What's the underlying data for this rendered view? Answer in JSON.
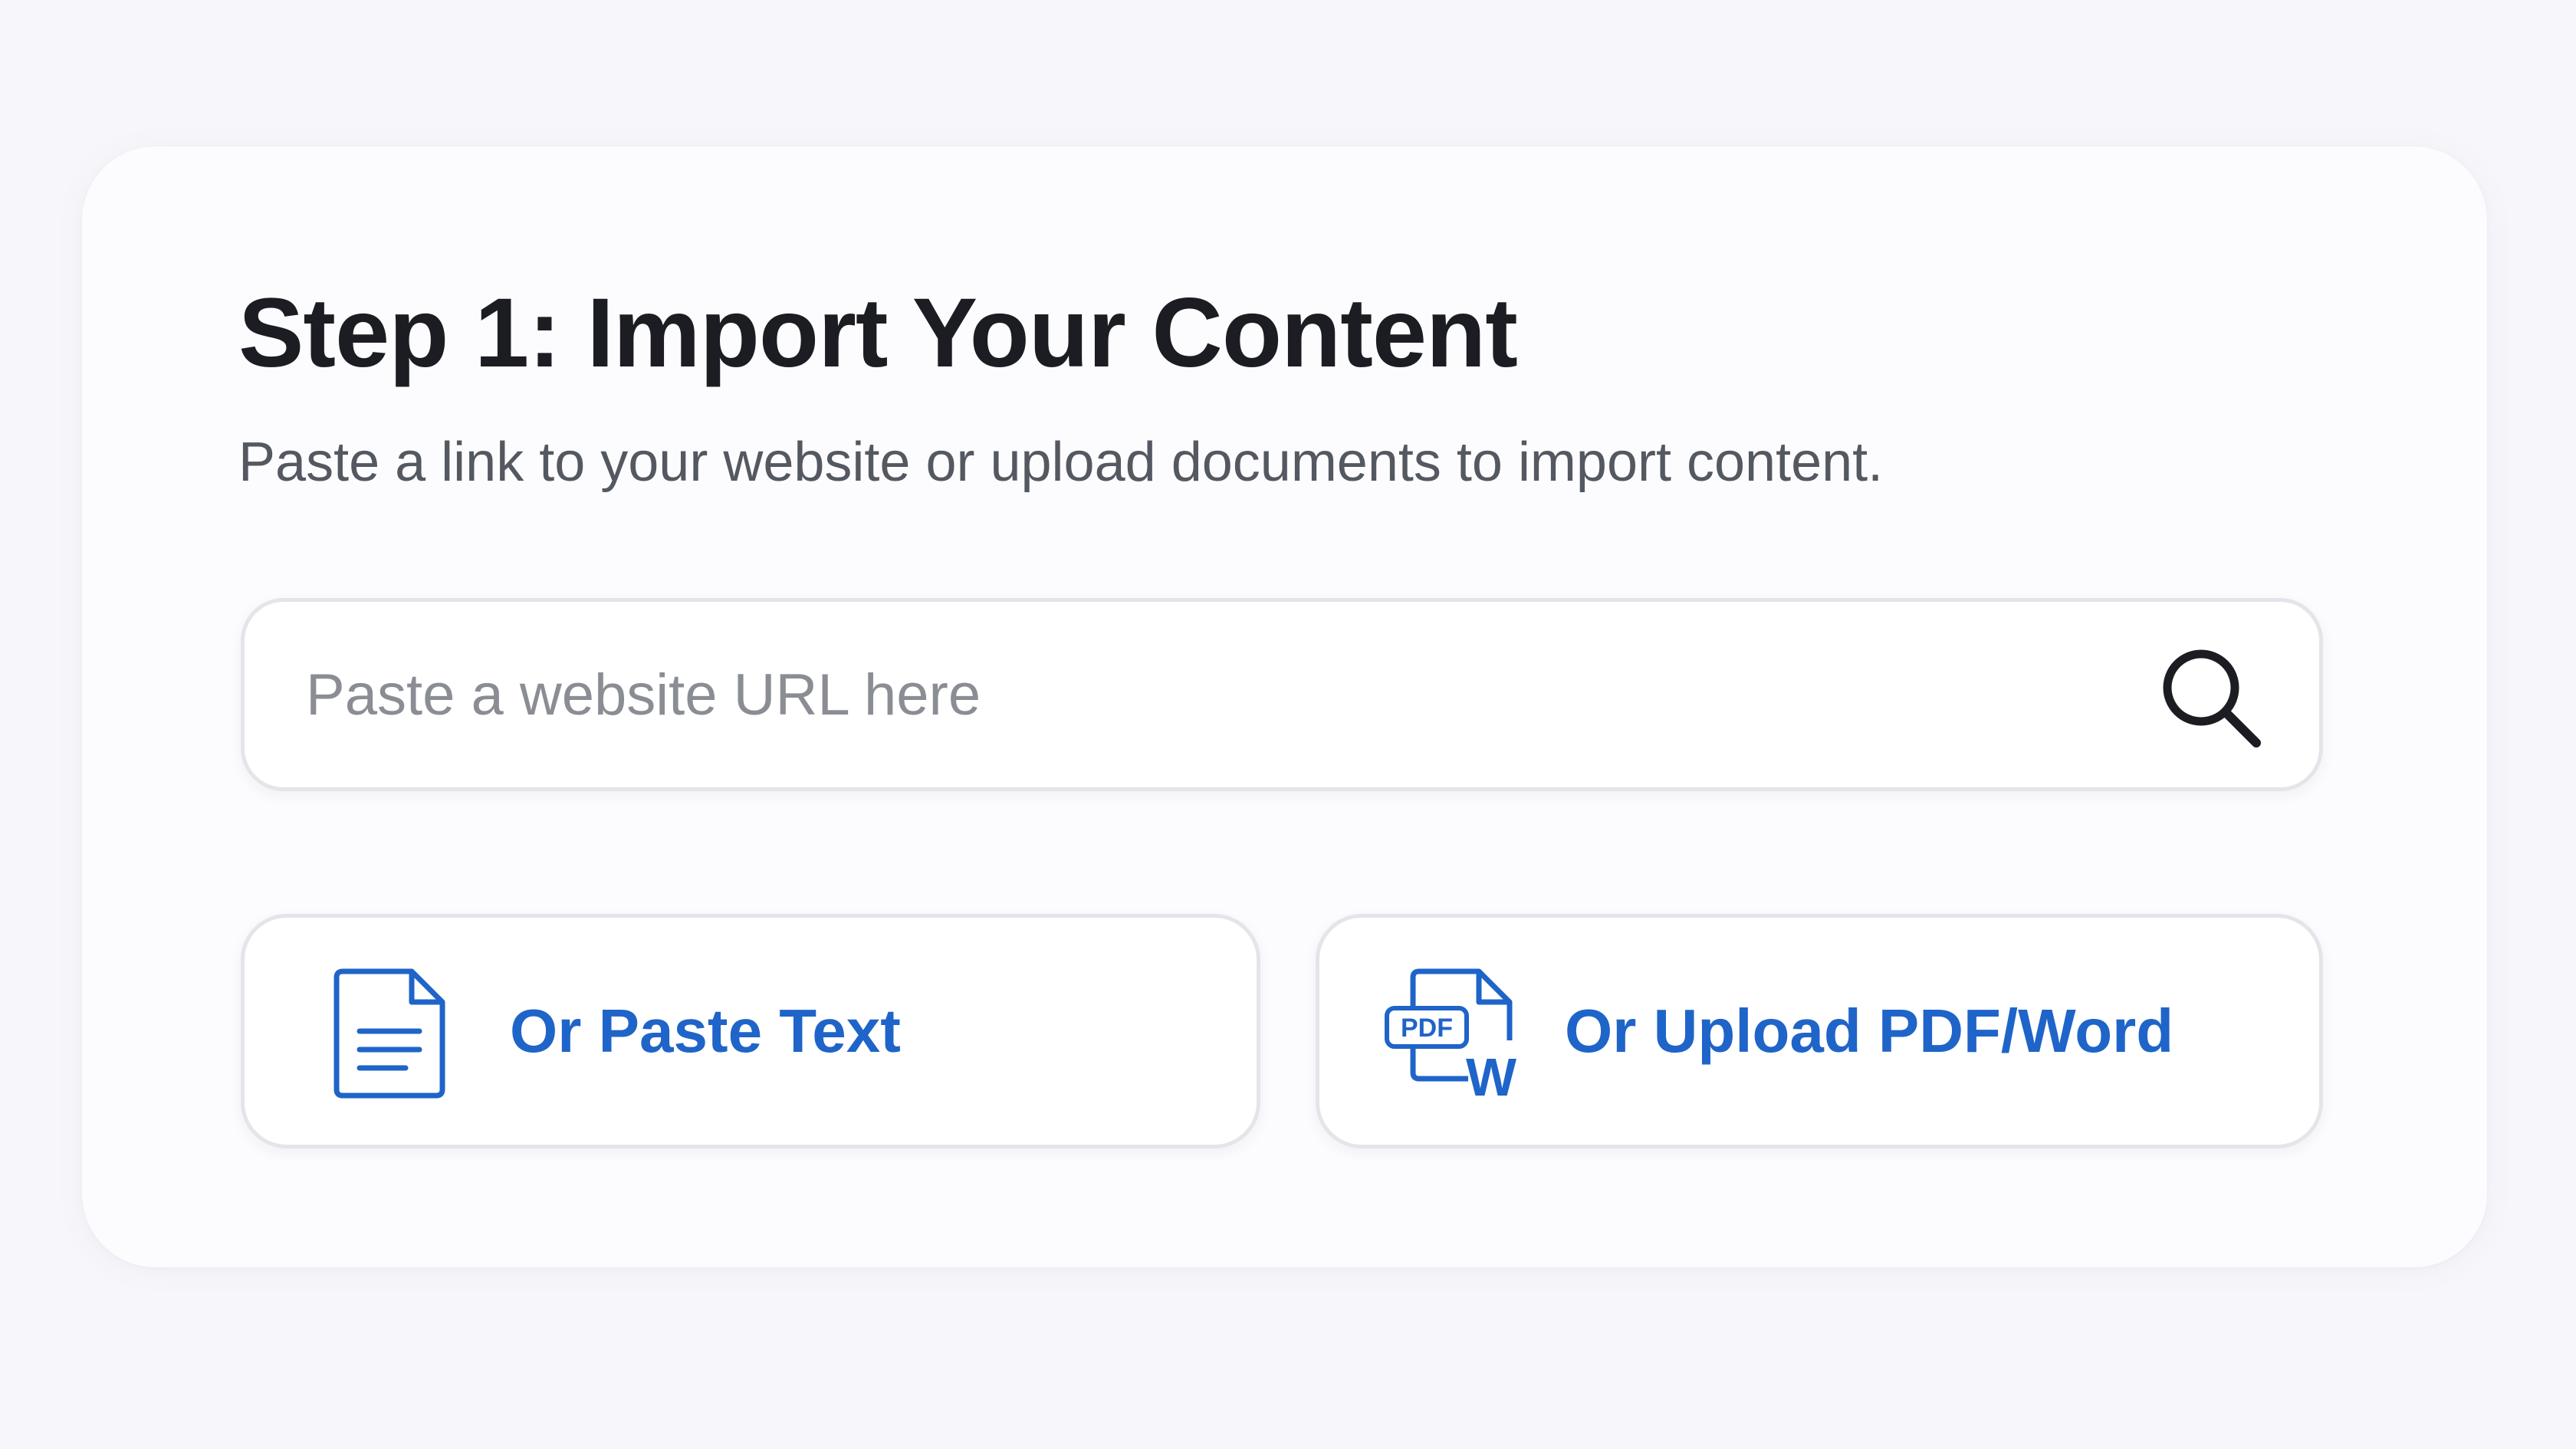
{
  "header": {
    "title": "Step 1: Import Your Content",
    "subtitle": "Paste a link to your website or upload documents to import content."
  },
  "url_input": {
    "value": "",
    "placeholder": "Paste a website URL here",
    "icon": "search-icon"
  },
  "options": {
    "paste_text": {
      "label": "Or Paste Text",
      "icon": "document-icon"
    },
    "upload_file": {
      "label": "Or Upload PDF/Word",
      "icon": "pdf-word-icon",
      "icon_text_pdf": "PDF",
      "icon_text_word": "W"
    }
  },
  "colors": {
    "accent": "#1f64c8",
    "title": "#1b1d22",
    "subtitle": "#545861",
    "placeholder": "#8a8d94",
    "border": "#e3e5ea",
    "background": "#f7f7fb"
  }
}
